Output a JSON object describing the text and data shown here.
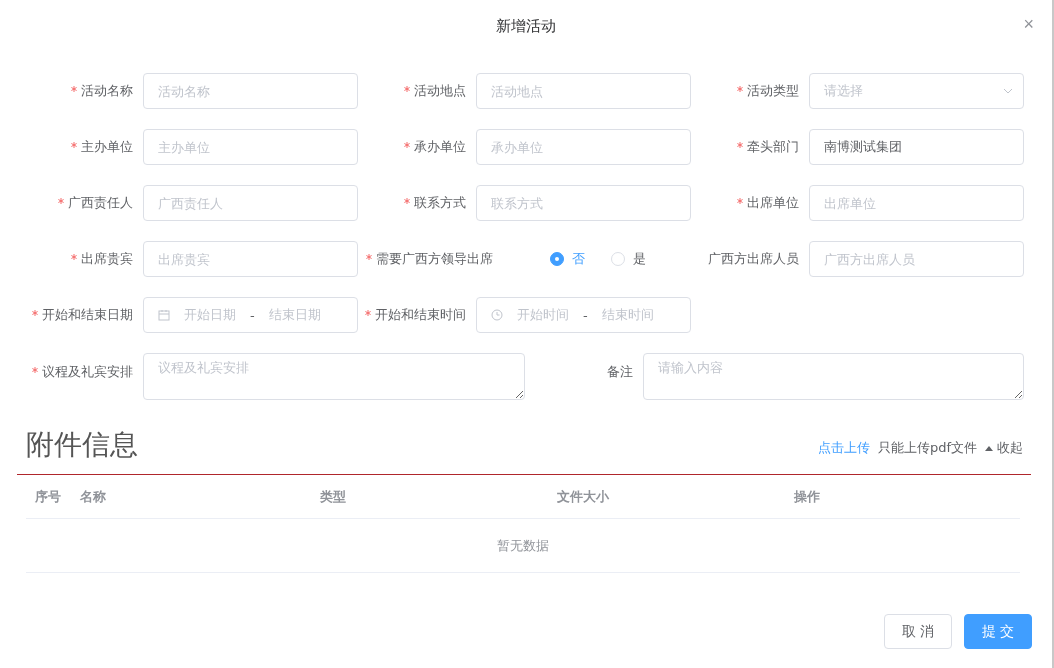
{
  "dialog": {
    "title": "新增活动",
    "close": "×"
  },
  "form": {
    "rows": [
      [
        {
          "kind": "input",
          "label": "活动名称",
          "required": true,
          "placeholder": "活动名称"
        },
        {
          "kind": "input",
          "label": "活动地点",
          "required": true,
          "placeholder": "活动地点"
        },
        {
          "kind": "select",
          "label": "活动类型",
          "required": true,
          "placeholder": "请选择"
        }
      ],
      [
        {
          "kind": "input",
          "label": "主办单位",
          "required": true,
          "placeholder": "主办单位"
        },
        {
          "kind": "input",
          "label": "承办单位",
          "required": true,
          "placeholder": "承办单位"
        },
        {
          "kind": "input",
          "label": "牵头部门",
          "required": true,
          "value": "南博测试集团"
        }
      ],
      [
        {
          "kind": "input",
          "label": "广西责任人",
          "required": true,
          "placeholder": "广西责任人"
        },
        {
          "kind": "input",
          "label": "联系方式",
          "required": true,
          "placeholder": "联系方式"
        },
        {
          "kind": "input",
          "label": "出席单位",
          "required": true,
          "placeholder": "出席单位"
        }
      ],
      [
        {
          "kind": "input",
          "label": "出席贵宾",
          "required": true,
          "placeholder": "出席贵宾"
        },
        {
          "kind": "radio",
          "label": "需要广西方领导出席",
          "required": true,
          "options": [
            {
              "label": "否",
              "selected": true
            },
            {
              "label": "是",
              "selected": false
            }
          ]
        },
        {
          "kind": "input",
          "label": "广西方出席人员",
          "required": false,
          "placeholder": "广西方出席人员"
        }
      ],
      [
        {
          "kind": "daterange",
          "label": "开始和结束日期",
          "required": true,
          "start": "开始日期",
          "separator": "-",
          "end": "结束日期"
        },
        {
          "kind": "timerange",
          "label": "开始和结束时间",
          "required": true,
          "start": "开始时间",
          "separator": "-",
          "end": "结束时间"
        }
      ]
    ],
    "wide_row": [
      {
        "label": "议程及礼宾安排",
        "required": true,
        "placeholder": "议程及礼宾安排"
      },
      {
        "label": "备注",
        "required": false,
        "placeholder": "请输入内容"
      }
    ]
  },
  "attachments": {
    "title": "附件信息",
    "upload": "点击上传",
    "hint": "只能上传pdf文件",
    "toggle": "收起",
    "columns": [
      "序号",
      "名称",
      "类型",
      "文件大小",
      "操作"
    ],
    "empty": "暂无数据"
  },
  "buttons": [
    {
      "label": "取 消",
      "kind": "default"
    },
    {
      "label": "提 交",
      "kind": "primary"
    }
  ]
}
